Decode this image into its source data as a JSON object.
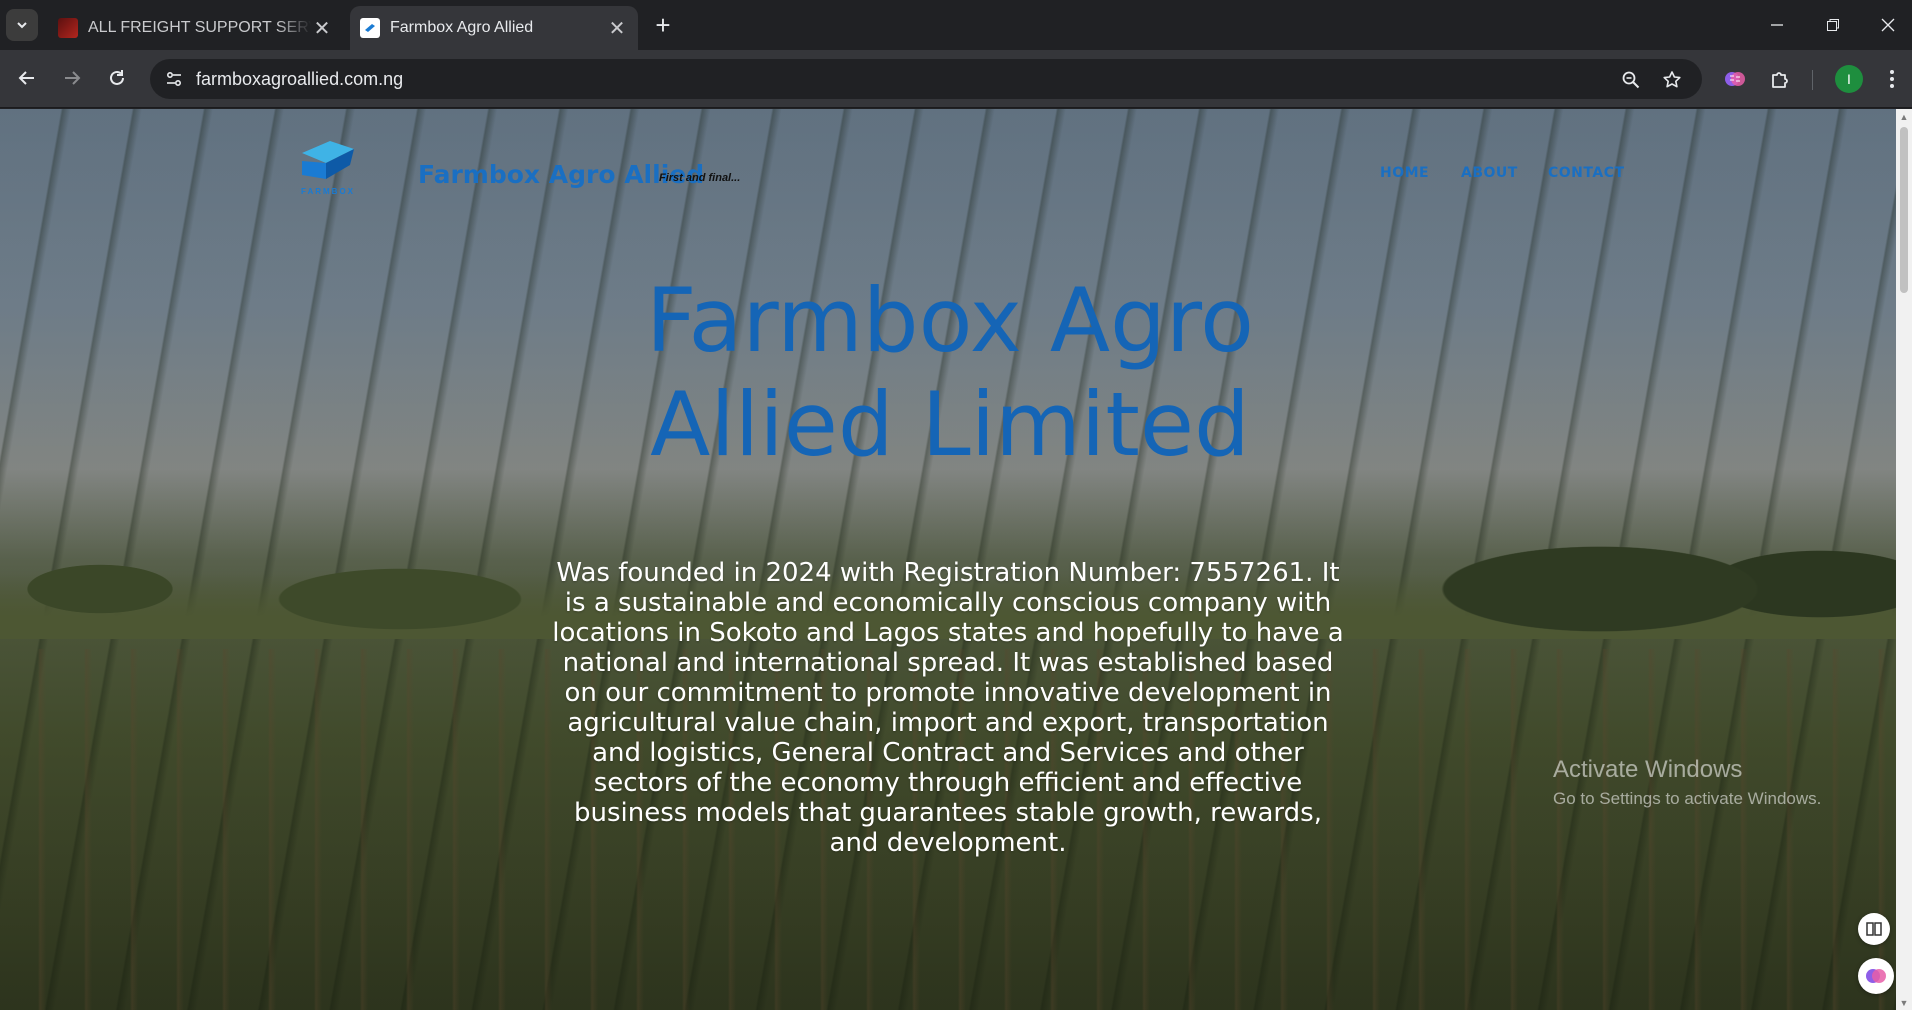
{
  "browser": {
    "tabs": [
      {
        "title": "ALL FREIGHT SUPPORT SERVICES",
        "active": false
      },
      {
        "title": "Farmbox Agro Allied",
        "active": true
      }
    ],
    "url": "farmboxagroallied.com.ng",
    "profile_initial": "I",
    "icons": [
      "tab-search-icon",
      "back-icon",
      "forward-icon",
      "reload-icon",
      "site-info-icon",
      "zoom-icon",
      "bookmark-star-icon",
      "extension-brain-icon",
      "extensions-puzzle-icon",
      "menu-kebab-icon",
      "minimize-icon",
      "restore-icon",
      "close-window-icon"
    ]
  },
  "site": {
    "logo_text": "FARMBOX",
    "brand": "Farmbox Agro Allied",
    "tagline": "First and final...",
    "nav": [
      "HOME",
      "ABOUT",
      "CONTACT"
    ],
    "accent_color": "#1a6fc2"
  },
  "hero": {
    "title_line1": "Farmbox Agro",
    "title_line2": "Allied Limited",
    "body": "Was founded in 2024 with Registration Number: 7557261. It is a sustainable and economically conscious company with locations in Sokoto and Lagos states and hopefully to have a national and international spread. It was established based on our commitment to promote innovative development in agricultural value chain, import and export, transportation and logistics, General Contract and Services and other sectors of the economy through efficient and effective business models that guarantees stable growth, rewards, and development."
  },
  "os_watermark": {
    "line1": "Activate Windows",
    "line2": "Go to Settings to activate Windows."
  }
}
